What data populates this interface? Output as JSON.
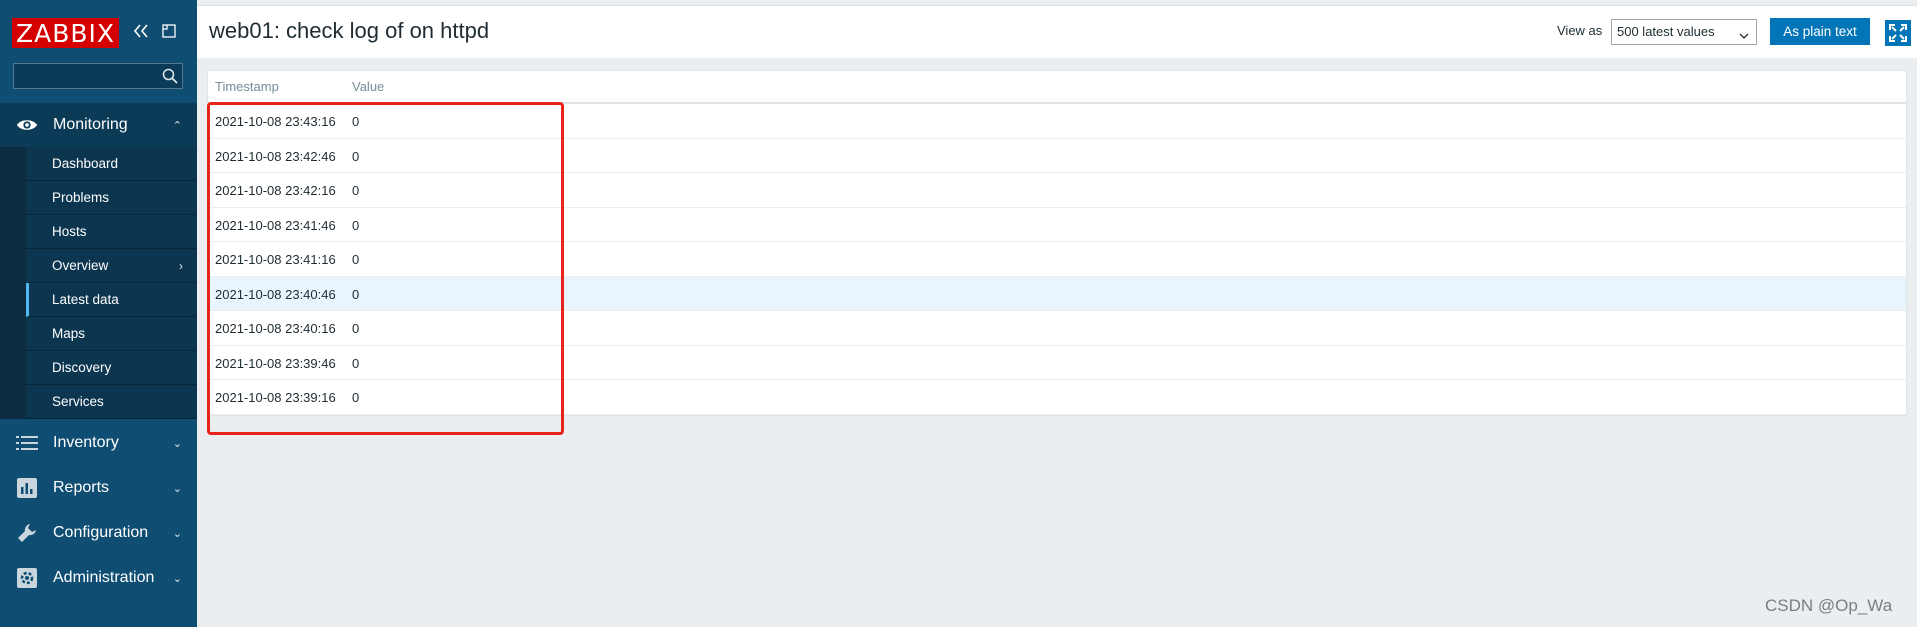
{
  "app": {
    "logo": "ZABBIX",
    "search": {
      "value": "",
      "placeholder": ""
    }
  },
  "sidebar": {
    "monitoring": {
      "label": "Monitoring",
      "items": [
        {
          "label": "Dashboard"
        },
        {
          "label": "Problems"
        },
        {
          "label": "Hosts"
        },
        {
          "label": "Overview"
        },
        {
          "label": "Latest data"
        },
        {
          "label": "Maps"
        },
        {
          "label": "Discovery"
        },
        {
          "label": "Services"
        }
      ]
    },
    "sections": [
      {
        "label": "Inventory"
      },
      {
        "label": "Reports"
      },
      {
        "label": "Configuration"
      },
      {
        "label": "Administration"
      }
    ]
  },
  "header": {
    "title": "web01: check log of on httpd",
    "view_as_label": "View as",
    "view_as_selected": "500 latest values",
    "plain_text_button": "As plain text"
  },
  "table": {
    "columns": [
      "Timestamp",
      "Value"
    ],
    "rows": [
      {
        "timestamp": "2021-10-08 23:43:16",
        "value": "0"
      },
      {
        "timestamp": "2021-10-08 23:42:46",
        "value": "0"
      },
      {
        "timestamp": "2021-10-08 23:42:16",
        "value": "0"
      },
      {
        "timestamp": "2021-10-08 23:41:46",
        "value": "0"
      },
      {
        "timestamp": "2021-10-08 23:41:16",
        "value": "0"
      },
      {
        "timestamp": "2021-10-08 23:40:46",
        "value": "0"
      },
      {
        "timestamp": "2021-10-08 23:40:16",
        "value": "0"
      },
      {
        "timestamp": "2021-10-08 23:39:46",
        "value": "0"
      },
      {
        "timestamp": "2021-10-08 23:39:16",
        "value": "0"
      }
    ]
  },
  "watermark": "CSDN @Op_Wa",
  "colors": {
    "sidebar_bg": "#0f4d72",
    "brand_red": "#d40000",
    "accent_blue": "#0275b8",
    "annotation_red": "#e8231a",
    "row_highlight": "#e8f5ff"
  }
}
